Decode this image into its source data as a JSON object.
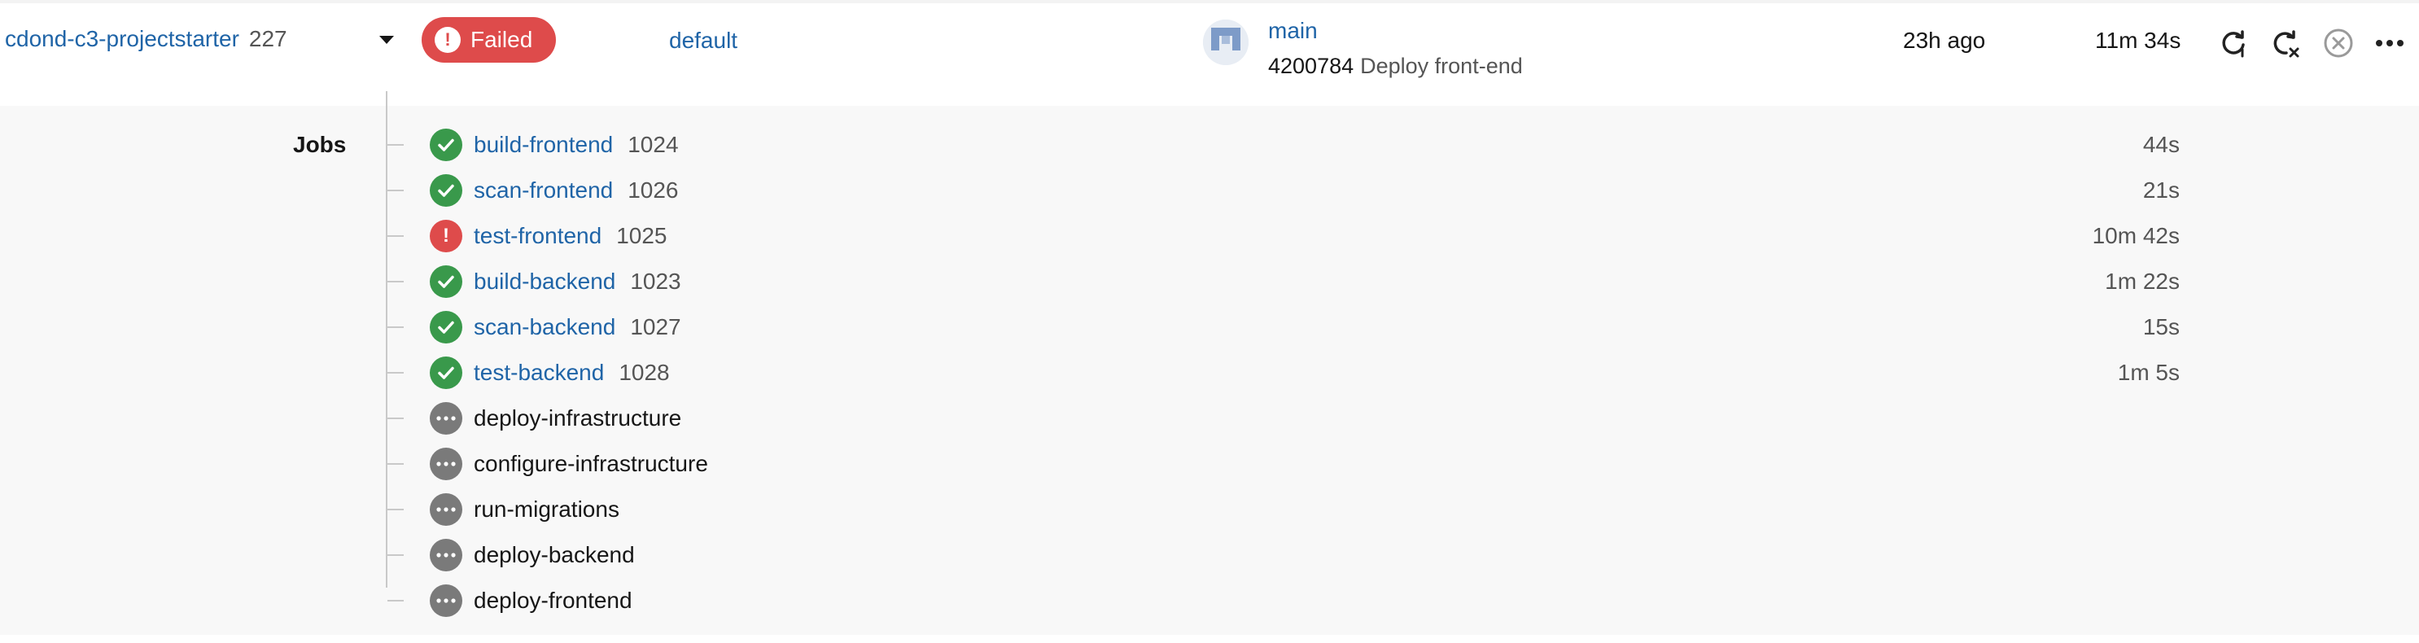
{
  "pipeline": {
    "project_name": "cdond-c3-projectstarter",
    "pipeline_number": "227",
    "status_label": "Failed",
    "context": "default",
    "branch": "main",
    "commit_sha": "4200784",
    "commit_message": "Deploy front-end",
    "started_ago": "23h ago",
    "duration": "11m 34s"
  },
  "jobs_section": {
    "label": "Jobs",
    "jobs": [
      {
        "name": "build-frontend",
        "number": "1024",
        "status": "success",
        "duration": "44s"
      },
      {
        "name": "scan-frontend",
        "number": "1026",
        "status": "success",
        "duration": "21s"
      },
      {
        "name": "test-frontend",
        "number": "1025",
        "status": "failed",
        "duration": "10m 42s"
      },
      {
        "name": "build-backend",
        "number": "1023",
        "status": "success",
        "duration": "1m 22s"
      },
      {
        "name": "scan-backend",
        "number": "1027",
        "status": "success",
        "duration": "15s"
      },
      {
        "name": "test-backend",
        "number": "1028",
        "status": "success",
        "duration": "1m 5s"
      },
      {
        "name": "deploy-infrastructure",
        "number": "",
        "status": "pending",
        "duration": ""
      },
      {
        "name": "configure-infrastructure",
        "number": "",
        "status": "pending",
        "duration": ""
      },
      {
        "name": "run-migrations",
        "number": "",
        "status": "pending",
        "duration": ""
      },
      {
        "name": "deploy-backend",
        "number": "",
        "status": "pending",
        "duration": ""
      },
      {
        "name": "deploy-frontend",
        "number": "",
        "status": "pending",
        "duration": ""
      }
    ]
  },
  "icons": {
    "status_alert": "alert-circle-icon",
    "expand": "chevron-down-icon",
    "rerun": "rerun-icon",
    "rerun_failed": "rerun-failed-icon",
    "cancel": "cancel-icon",
    "more": "more-icon"
  },
  "colors": {
    "link": "#1f64a7",
    "failed": "#de4b4b",
    "success": "#39994b",
    "pending": "#7a7a7a",
    "jobs_background": "#f8f8f8"
  }
}
